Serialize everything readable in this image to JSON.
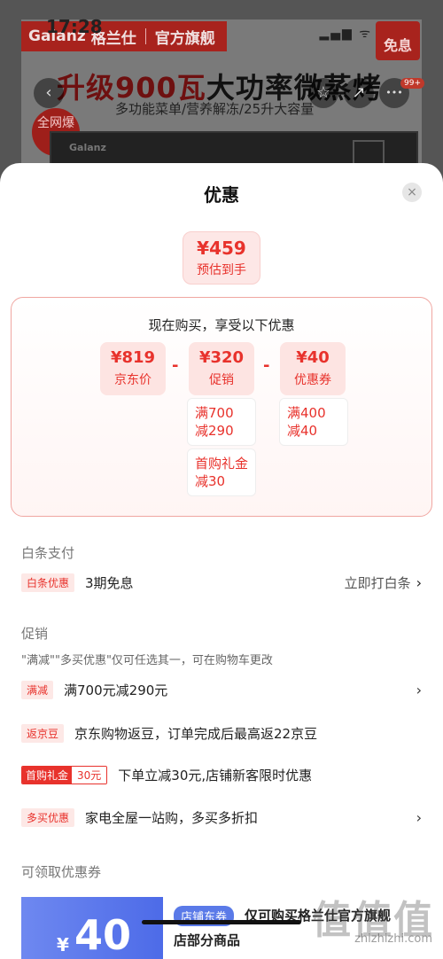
{
  "status": {
    "time": "17:28",
    "icons": "▂▄▆ ᯤ"
  },
  "product_page": {
    "brand": "Galanz",
    "brand_cn": "格兰仕",
    "store_label": "官方旗舰",
    "free_badge": "免息",
    "headline_red": "升级900瓦",
    "headline_dark": "大功率微蒸烤",
    "subline": "多功能菜单/营养解冻/25升大容量",
    "hot_badge": "全网爆款",
    "device_logo": "Galanz",
    "notification_count": "99+",
    "back_icon": "‹",
    "share_icon": "↗",
    "star_icon": "☆",
    "more_icon": "•••"
  },
  "sheet": {
    "title": "优惠",
    "close_icon": "×",
    "estimate": {
      "value": "¥459",
      "label": "预估到手"
    },
    "calc": {
      "heading": "现在购买，享受以下优惠",
      "items": [
        {
          "value": "¥819",
          "label": "京东价"
        },
        {
          "value": "¥320",
          "label": "促销"
        },
        {
          "value": "¥40",
          "label": "优惠券"
        }
      ],
      "minus": "-",
      "promo_details": [
        {
          "line1": "满700",
          "line2": "减290"
        },
        {
          "line1": "首购礼金",
          "line2": "减30"
        }
      ],
      "coupon_details": [
        {
          "line1": "满400",
          "line2": "减40"
        }
      ]
    },
    "baitiao": {
      "title": "白条支付",
      "tag": "白条优惠",
      "text": "3期免息",
      "action": "立即打白条",
      "chevron": "›"
    },
    "promo": {
      "title": "促销",
      "note": "\"满减\"\"多买优惠\"仅可任选其一，可在购物车更改",
      "rows": [
        {
          "tag": "满减",
          "text": "满700元减290元",
          "chevron": "›"
        },
        {
          "tag": "返京豆",
          "text": "京东购物返豆，订单完成后最高返22京豆",
          "chevron": ""
        },
        {
          "tag_a": "首购礼金",
          "tag_b": "30元",
          "text": "下单立减30元,店铺新客限时优惠",
          "chevron": ""
        },
        {
          "tag": "多买优惠",
          "text": "家电全屋一站购，多买多折扣",
          "chevron": "›"
        }
      ]
    },
    "coupons": {
      "title": "可领取优惠券",
      "currency": "¥",
      "amount": "40",
      "tag": "店铺东券",
      "text": "仅可购买格兰仕官方旗舰",
      "text2": "店部分商品"
    }
  },
  "watermark": {
    "text": "值值值",
    "url": "zhizhizhi.com"
  }
}
